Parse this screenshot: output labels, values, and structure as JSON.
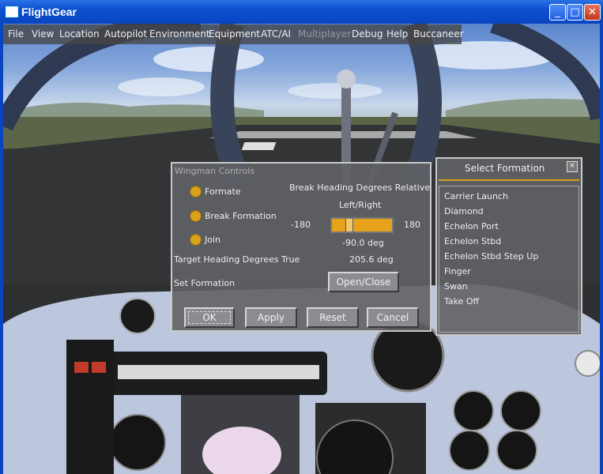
{
  "window": {
    "title": "FlightGear",
    "minimize_glyph": "_",
    "maximize_glyph": "□",
    "close_glyph": "✕"
  },
  "menu": {
    "items": [
      "File",
      "View",
      "Location",
      "Autopilot",
      "Environment",
      "Equipment",
      "ATC/AI",
      "Multiplayer",
      "Debug",
      "Help",
      "Buccaneer"
    ]
  },
  "wingman": {
    "title": "Wingman Controls",
    "options": [
      "Formate",
      "Break Formation",
      "Join"
    ],
    "break_heading_label": "Break Heading Degrees Relative",
    "left_right_label": "Left/Right",
    "slider_min": "-180",
    "slider_max": "180",
    "slider_value": -90,
    "slider_value_text": "-90.0 deg",
    "target_heading_label": "Target Heading Degrees True",
    "target_heading_value": "205.6 deg",
    "set_formation_label": "Set Formation",
    "open_close_label": "Open/Close",
    "ok_label": "OK",
    "apply_label": "Apply",
    "reset_label": "Reset",
    "cancel_label": "Cancel"
  },
  "select_formation": {
    "title": "Select Formation",
    "items": [
      "Carrier Launch",
      "Diamond",
      "Echelon Port",
      "Echelon Stbd",
      "Echelon Stbd Step Up",
      "Finger",
      "Swan",
      "Take Off"
    ]
  },
  "colors": {
    "accent": "#d8a21a",
    "panel": "#606266"
  }
}
